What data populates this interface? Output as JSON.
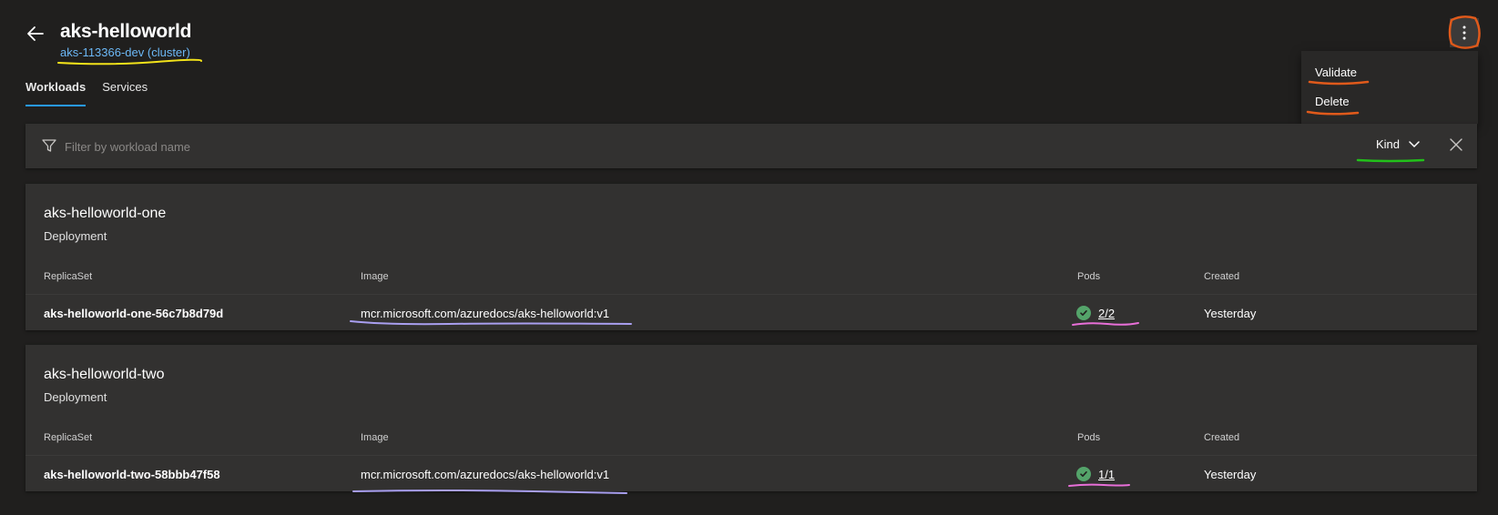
{
  "header": {
    "title": "aks-helloworld",
    "cluster_link": "aks-113366-dev (cluster)"
  },
  "tabs": [
    {
      "label": "Workloads",
      "active": true
    },
    {
      "label": "Services",
      "active": false
    }
  ],
  "more_menu": {
    "icon": "more-vertical-icon",
    "items": [
      {
        "label": "Validate"
      },
      {
        "label": "Delete"
      }
    ]
  },
  "filter": {
    "placeholder": "Filter by workload name",
    "value": "",
    "kind_label": "Kind"
  },
  "columns": {
    "replicaset": "ReplicaSet",
    "image": "Image",
    "pods": "Pods",
    "created": "Created"
  },
  "workloads": [
    {
      "name": "aks-helloworld-one",
      "kind": "Deployment",
      "replicaset": "aks-helloworld-one-56c7b8d79d",
      "image": "mcr.microsoft.com/azuredocs/aks-helloworld:v1",
      "pods": "2/2",
      "created": "Yesterday"
    },
    {
      "name": "aks-helloworld-two",
      "kind": "Deployment",
      "replicaset": "aks-helloworld-two-58bbb47f58",
      "image": "mcr.microsoft.com/azuredocs/aks-helloworld:v1",
      "pods": "1/1",
      "created": "Yesterday"
    }
  ],
  "colors": {
    "background": "#201f1e",
    "surface": "#323130",
    "accent": "#2899f5",
    "link": "#6cb8f6",
    "success": "#54a46a",
    "annotation_orange": "#e05a1b",
    "annotation_yellow": "#f2e21a",
    "annotation_green": "#22c01a",
    "annotation_purple": "#a99ff0",
    "annotation_pink": "#e86fd8"
  }
}
